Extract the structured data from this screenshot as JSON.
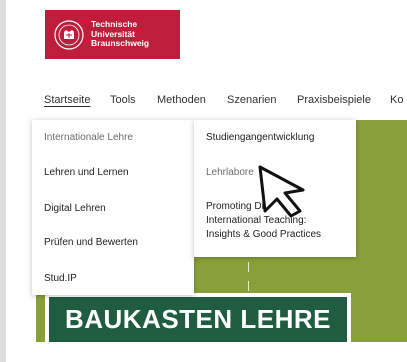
{
  "logo": {
    "lines": [
      "Technische",
      "Universität",
      "Braunschweig"
    ]
  },
  "nav": {
    "items": [
      "Startseite",
      "Tools",
      "Methoden",
      "Szenarien",
      "Praxisbeispiele",
      "Ko"
    ]
  },
  "menu_left": {
    "items": [
      "Internationale Lehre",
      "Lehren und Lernen",
      "Digital Lehren",
      "Prüfen und Bewerten",
      "Stud.IP"
    ]
  },
  "menu_right": {
    "items": [
      "Studiengangentwicklung",
      "Lehrlabore"
    ],
    "promoting_lines": [
      "Promoting Di",
      "International Teaching:",
      "Insights & Good Practices"
    ]
  },
  "banner": {
    "title": "BAUKASTEN LEHRE"
  },
  "colors": {
    "brand_red": "#be1e3c",
    "hero_green": "#89a03a",
    "banner_green": "#1f5c40"
  },
  "icons": {
    "logo": "university-seal-icon",
    "cursor": "mouse-pointer-icon"
  }
}
